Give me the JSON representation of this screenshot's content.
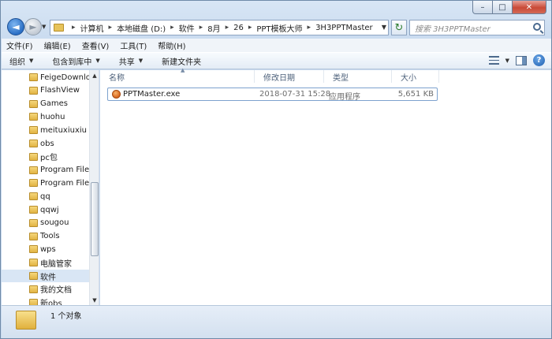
{
  "window": {
    "min_glyph": "–",
    "max_glyph": "□",
    "close_glyph": "✕"
  },
  "nav": {
    "back_glyph": "◄",
    "forward_glyph": "►"
  },
  "address": {
    "breadcrumbs": [
      "计算机",
      "本地磁盘 (D:)",
      "软件",
      "8月",
      "26",
      "PPT模板大师",
      "3H3PPTMaster"
    ]
  },
  "search": {
    "placeholder": "搜索 3H3PPTMaster"
  },
  "menu": [
    "文件(F)",
    "编辑(E)",
    "查看(V)",
    "工具(T)",
    "帮助(H)"
  ],
  "toolbar": {
    "organize": "组织",
    "include_in_library": "包含到库中",
    "share": "共享",
    "new_folder": "新建文件夹"
  },
  "tree": [
    {
      "label": "FeigeDownload",
      "selected": false
    },
    {
      "label": "FlashView",
      "selected": false
    },
    {
      "label": "Games",
      "selected": false
    },
    {
      "label": "huohu",
      "selected": false
    },
    {
      "label": "meituxiuxiu",
      "selected": false
    },
    {
      "label": "obs",
      "selected": false
    },
    {
      "label": "pc包",
      "selected": false
    },
    {
      "label": "Program Files",
      "selected": false
    },
    {
      "label": "Program Files",
      "selected": false
    },
    {
      "label": "qq",
      "selected": false
    },
    {
      "label": "qqwj",
      "selected": false
    },
    {
      "label": "sougou",
      "selected": false
    },
    {
      "label": "Tools",
      "selected": false
    },
    {
      "label": "wps",
      "selected": false
    },
    {
      "label": "电脑管家",
      "selected": false
    },
    {
      "label": "软件",
      "selected": true
    },
    {
      "label": "我的文档",
      "selected": false
    },
    {
      "label": "新obs",
      "selected": false
    }
  ],
  "columns": {
    "name": "名称",
    "modified": "修改日期",
    "type": "类型",
    "size": "大小"
  },
  "files": [
    {
      "name": "PPTMaster.exe",
      "modified": "2018-07-31 15:28",
      "type": "应用程序",
      "size": "5,651 KB",
      "icon": "exe-icon"
    }
  ],
  "status": {
    "text": "1 个对象"
  }
}
